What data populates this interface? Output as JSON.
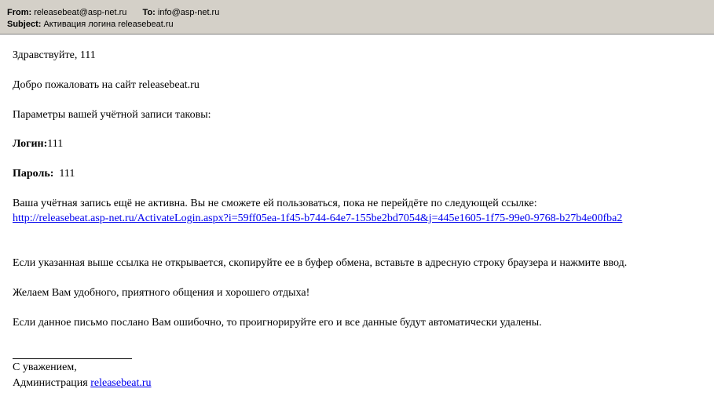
{
  "header": {
    "from_label": "From:",
    "from_value": "releasebeat@asp-net.ru",
    "to_label": "To:",
    "to_value": "info@asp-net.ru",
    "subject_label": "Subject:",
    "subject_value": "Активация логина releasebeat.ru",
    "background_color": "#d4d0c8"
  },
  "body": {
    "greeting": "Здравствуйте, 111",
    "welcome": "Добро пожаловать на сайт releasebeat.ru",
    "params_intro": "Параметры вашей учётной записи таковы:",
    "login_label": "Логин:",
    "login_value": "111",
    "password_label": "Пароль:",
    "password_value": "111",
    "not_active_text": "Ваша учётная запись ещё не активна. Вы не сможете ей пользоваться, пока не перейдёте по следующей ссылке:",
    "activation_link": "http://releasebeat.asp-net.ru/ActivateLogin.aspx?i=59ff05ea-1f45-b744-64e7-155be2bd7054&j=445e1605-1f75-99e0-9768-b27b4e00fba2",
    "copy_instructions": "Если указанная выше ссылка не открывается, скопируйте ее в буфер обмена, вставьте в адресную строку браузера и нажмите ввод.",
    "wishes": "Желаем Вам удобного, приятного общения и хорошего отдыха!",
    "mistake_note": "Если данное письмо послано Вам ошибочно, то проигнорируйте его и все данные будут автоматически удалены.",
    "signature_regards": "С уважением,",
    "signature_admin_prefix": "Администрация",
    "signature_site_link": "releasebeat.ru",
    "link_color": "#0000ee"
  }
}
